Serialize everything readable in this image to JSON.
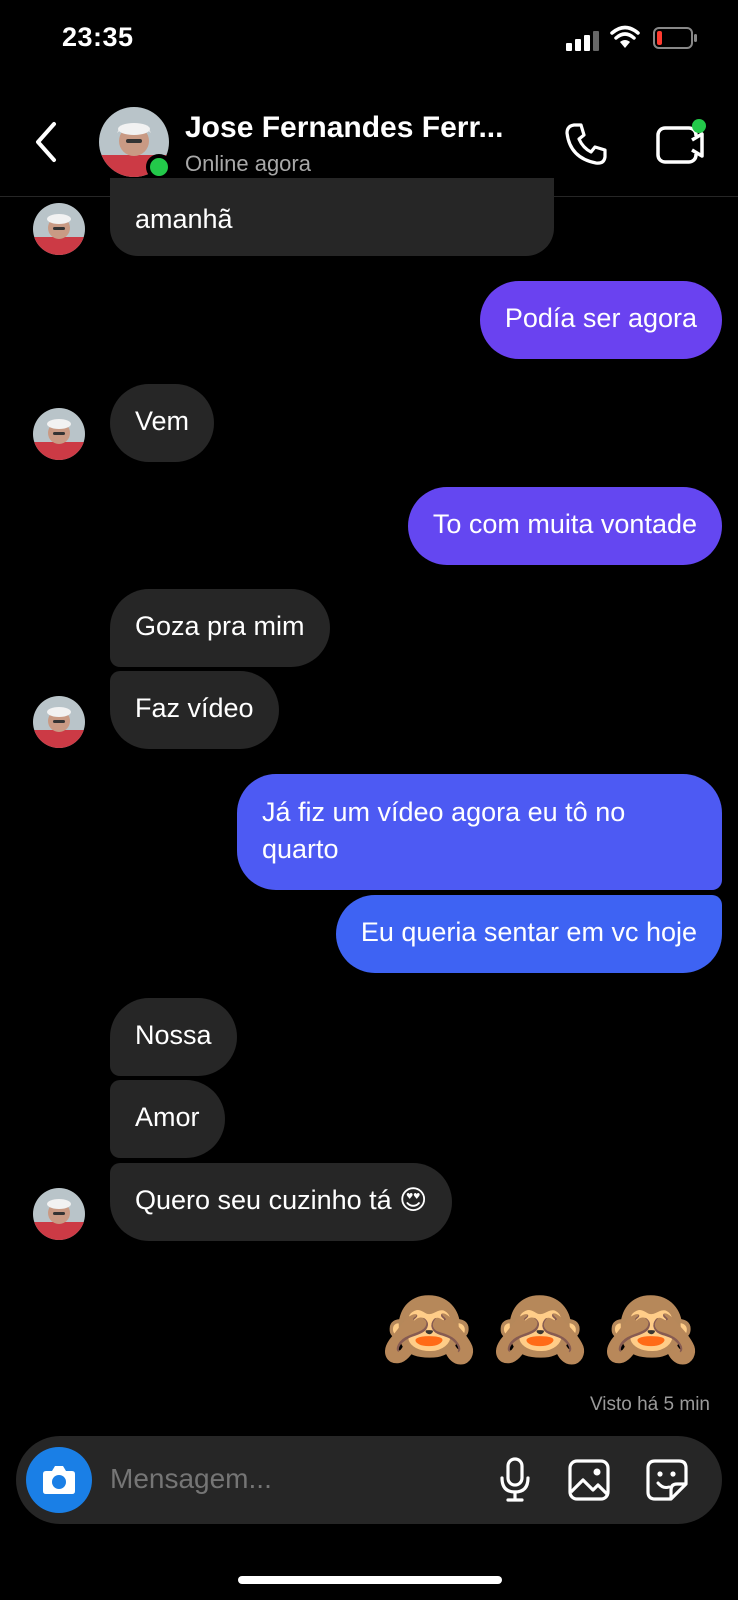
{
  "status_bar": {
    "time": "23:35"
  },
  "header": {
    "contact_name": "Jose Fernandes Ferr...",
    "contact_status": "Online agora",
    "icons": [
      "back-arrow",
      "phone",
      "video-camera"
    ]
  },
  "messages": [
    {
      "direction": "in",
      "text": "amanhã"
    },
    {
      "direction": "out",
      "text": "Podía ser agora",
      "color": "#6a42f0"
    },
    {
      "direction": "in",
      "text": "Vem"
    },
    {
      "direction": "out",
      "text": "To com muita vontade",
      "color": "#6447f1"
    },
    {
      "direction": "in",
      "text": "Goza pra mim"
    },
    {
      "direction": "in",
      "text": "Faz vídeo"
    },
    {
      "direction": "out",
      "text_line1": "Já fiz um vídeo agora eu tô no",
      "text_line2": "quarto",
      "color": "#4d5af3"
    },
    {
      "direction": "out",
      "text": "Eu queria sentar em vc hoje",
      "color": "#3e63f3"
    },
    {
      "direction": "in",
      "text": "Nossa"
    },
    {
      "direction": "in",
      "text": "Amor"
    },
    {
      "direction": "in",
      "text": "Quero seu cuzinho tá 😍"
    },
    {
      "direction": "out",
      "text": "🙈🙈🙈"
    }
  ],
  "seen_text": "Visto há 5 min",
  "composer": {
    "placeholder": "Mensagem...",
    "icons": [
      "camera",
      "microphone",
      "gallery",
      "sticker"
    ]
  },
  "colors": {
    "background": "#000000",
    "incoming_bubble": "#262626",
    "online": "#23c94a",
    "camera_button": "#1a7fe6"
  }
}
